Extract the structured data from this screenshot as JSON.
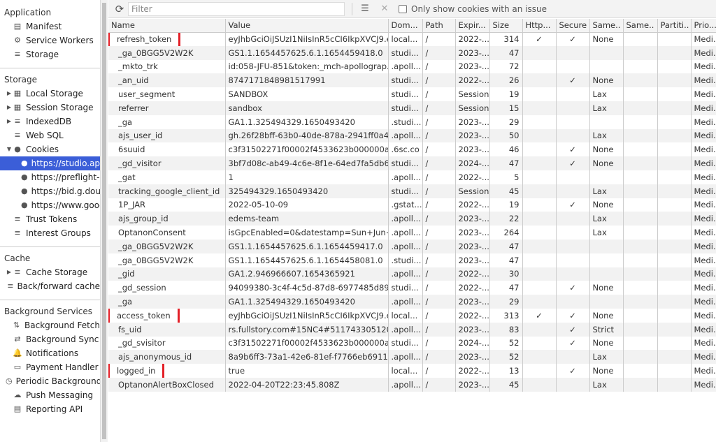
{
  "sidebar": {
    "sections": [
      {
        "title": "Application",
        "items": [
          {
            "label": "Manifest",
            "icon": "file-icon"
          },
          {
            "label": "Service Workers",
            "icon": "gear-icon"
          },
          {
            "label": "Storage",
            "icon": "database-icon"
          }
        ]
      },
      {
        "title": "Storage",
        "items": [
          {
            "label": "Local Storage",
            "icon": "grid-icon",
            "twisty": "right"
          },
          {
            "label": "Session Storage",
            "icon": "grid-icon",
            "twisty": "right"
          },
          {
            "label": "IndexedDB",
            "icon": "database-icon",
            "twisty": "right"
          },
          {
            "label": "Web SQL",
            "icon": "database-icon"
          },
          {
            "label": "Cookies",
            "icon": "cookie-icon",
            "twisty": "down"
          },
          {
            "label": "https://studio.apollographql.com",
            "icon": "cookie-icon",
            "child": true,
            "selected": true
          },
          {
            "label": "https://preflight-request",
            "icon": "cookie-icon",
            "child": true
          },
          {
            "label": "https://bid.g.doubleclick.net",
            "icon": "cookie-icon",
            "child": true
          },
          {
            "label": "https://www.google.com",
            "icon": "cookie-icon",
            "child": true
          },
          {
            "label": "Trust Tokens",
            "icon": "database-icon"
          },
          {
            "label": "Interest Groups",
            "icon": "database-icon"
          }
        ]
      },
      {
        "title": "Cache",
        "items": [
          {
            "label": "Cache Storage",
            "icon": "database-icon",
            "twisty": "right"
          },
          {
            "label": "Back/forward cache",
            "icon": "database-icon"
          }
        ]
      },
      {
        "title": "Background Services",
        "items": [
          {
            "label": "Background Fetch",
            "icon": "arrows-icon"
          },
          {
            "label": "Background Sync",
            "icon": "sync-icon"
          },
          {
            "label": "Notifications",
            "icon": "bell-icon"
          },
          {
            "label": "Payment Handler",
            "icon": "card-icon"
          },
          {
            "label": "Periodic Background Sync",
            "icon": "clock-icon"
          },
          {
            "label": "Push Messaging",
            "icon": "cloud-icon"
          },
          {
            "label": "Reporting API",
            "icon": "file-icon"
          }
        ]
      }
    ]
  },
  "toolbar": {
    "filter_placeholder": "Filter",
    "only_issue_label": "Only show cookies with an issue"
  },
  "table": {
    "columns": [
      "Name",
      "Value",
      "Dom...",
      "Path",
      "Expir...",
      "Size",
      "Http...",
      "Secure",
      "Same..",
      "Same..",
      "Partiti..",
      "Prio..."
    ],
    "highlight_color": "#e32028",
    "rows": [
      {
        "c": [
          "refresh_token",
          "eyJhbGciOiJSUzI1NiIsInR5cCI6IkpXVCJ9.e...",
          "local...",
          "/",
          "2022-...",
          "314",
          "✓",
          "✓",
          "None",
          "",
          "",
          "Medi..."
        ],
        "hl": true
      },
      {
        "c": [
          "_ga_0BGG5V2W2K",
          "GS1.1.1654457625.6.1.1654459418.0",
          "studi...",
          "/",
          "2023-...",
          "47",
          "",
          "",
          "",
          "",
          "",
          "Medi..."
        ]
      },
      {
        "c": [
          "_mkto_trk",
          "id:058-JFU-851&token:_mch-apollograp...",
          ".apoll...",
          "/",
          "2023-...",
          "72",
          "",
          "",
          "",
          "",
          "",
          "Medi..."
        ]
      },
      {
        "c": [
          "_an_uid",
          "8747171848981517991",
          "studi...",
          "/",
          "2022-...",
          "26",
          "",
          "✓",
          "None",
          "",
          "",
          "Medi..."
        ]
      },
      {
        "c": [
          "user_segment",
          "SANDBOX",
          "studi...",
          "/",
          "Session",
          "19",
          "",
          "",
          "Lax",
          "",
          "",
          "Medi..."
        ]
      },
      {
        "c": [
          "referrer",
          "sandbox",
          "studi...",
          "/",
          "Session",
          "15",
          "",
          "",
          "Lax",
          "",
          "",
          "Medi..."
        ]
      },
      {
        "c": [
          "_ga",
          "GA1.1.325494329.1650493420",
          ".studi...",
          "/",
          "2023-...",
          "29",
          "",
          "",
          "",
          "",
          "",
          "Medi..."
        ]
      },
      {
        "c": [
          "ajs_user_id",
          "gh.26f28bff-63b0-40de-878a-2941ff0a48...",
          ".apoll...",
          "/",
          "2023-...",
          "50",
          "",
          "",
          "Lax",
          "",
          "",
          "Medi..."
        ]
      },
      {
        "c": [
          "6suuid",
          "c3f31502271f00002f4533623b000000a1f...",
          ".6sc.co",
          "/",
          "2023-...",
          "46",
          "",
          "✓",
          "None",
          "",
          "",
          "Medi..."
        ]
      },
      {
        "c": [
          "_gd_visitor",
          "3bf7d08c-ab49-4c6e-8f1e-64ed7fa5db60",
          "studi...",
          "/",
          "2024-...",
          "47",
          "",
          "✓",
          "None",
          "",
          "",
          "Medi..."
        ]
      },
      {
        "c": [
          "_gat",
          "1",
          ".apoll...",
          "/",
          "2022-...",
          "5",
          "",
          "",
          "",
          "",
          "",
          "Medi..."
        ]
      },
      {
        "c": [
          "tracking_google_client_id",
          "325494329.1650493420",
          "studi...",
          "/",
          "Session",
          "45",
          "",
          "",
          "Lax",
          "",
          "",
          "Medi..."
        ]
      },
      {
        "c": [
          "1P_JAR",
          "2022-05-10-09",
          ".gstat...",
          "/",
          "2022-...",
          "19",
          "",
          "✓",
          "None",
          "",
          "",
          "Medi..."
        ]
      },
      {
        "c": [
          "ajs_group_id",
          "edems-team",
          ".apoll...",
          "/",
          "2023-...",
          "22",
          "",
          "",
          "Lax",
          "",
          "",
          "Medi..."
        ]
      },
      {
        "c": [
          "OptanonConsent",
          "isGpcEnabled=0&datestamp=Sun+Jun+...",
          ".apoll...",
          "/",
          "2023-...",
          "264",
          "",
          "",
          "Lax",
          "",
          "",
          "Medi..."
        ]
      },
      {
        "c": [
          "_ga_0BGG5V2W2K",
          "GS1.1.1654457625.6.1.1654459417.0",
          ".apoll...",
          "/",
          "2023-...",
          "47",
          "",
          "",
          "",
          "",
          "",
          "Medi..."
        ]
      },
      {
        "c": [
          "_ga_0BGG5V2W2K",
          "GS1.1.1654457625.6.1.1654458081.0",
          ".studi...",
          "/",
          "2023-...",
          "47",
          "",
          "",
          "",
          "",
          "",
          "Medi..."
        ]
      },
      {
        "c": [
          "_gid",
          "GA1.2.946966607.1654365921",
          ".apoll...",
          "/",
          "2022-...",
          "30",
          "",
          "",
          "",
          "",
          "",
          "Medi..."
        ]
      },
      {
        "c": [
          "_gd_session",
          "94099380-3c4f-4c5d-87d8-6977485d89ef",
          "studi...",
          "/",
          "2022-...",
          "47",
          "",
          "✓",
          "None",
          "",
          "",
          "Medi..."
        ]
      },
      {
        "c": [
          "_ga",
          "GA1.1.325494329.1650493420",
          ".apoll...",
          "/",
          "2023-...",
          "29",
          "",
          "",
          "",
          "",
          "",
          "Medi..."
        ]
      },
      {
        "c": [
          "access_token",
          "eyJhbGciOiJSUzI1NiIsInR5cCI6IkpXVCJ9.e...",
          "local...",
          "/",
          "2022-...",
          "313",
          "✓",
          "✓",
          "None",
          "",
          "",
          "Medi..."
        ],
        "hl": true
      },
      {
        "c": [
          "fs_uid",
          "rs.fullstory.com#15NC4#5117433051209...",
          ".apoll...",
          "/",
          "2023-...",
          "83",
          "",
          "✓",
          "Strict",
          "",
          "",
          "Medi..."
        ]
      },
      {
        "c": [
          "_gd_svisitor",
          "c3f31502271f00002f4533623b000000a1f...",
          "studi...",
          "/",
          "2024-...",
          "52",
          "",
          "✓",
          "None",
          "",
          "",
          "Medi..."
        ]
      },
      {
        "c": [
          "ajs_anonymous_id",
          "8a9b6ff3-73a1-42e6-81ef-f7766eb6911e",
          ".apoll...",
          "/",
          "2023-...",
          "52",
          "",
          "",
          "Lax",
          "",
          "",
          "Medi..."
        ]
      },
      {
        "c": [
          "logged_in",
          "true",
          "local...",
          "/",
          "2022-...",
          "13",
          "",
          "✓",
          "None",
          "",
          "",
          "Medi..."
        ],
        "hl": true
      },
      {
        "c": [
          "OptanonAlertBoxClosed",
          "2022-04-20T22:23:45.808Z",
          ".apoll...",
          "/",
          "2023-...",
          "45",
          "",
          "",
          "Lax",
          "",
          "",
          "Medi..."
        ]
      }
    ]
  }
}
